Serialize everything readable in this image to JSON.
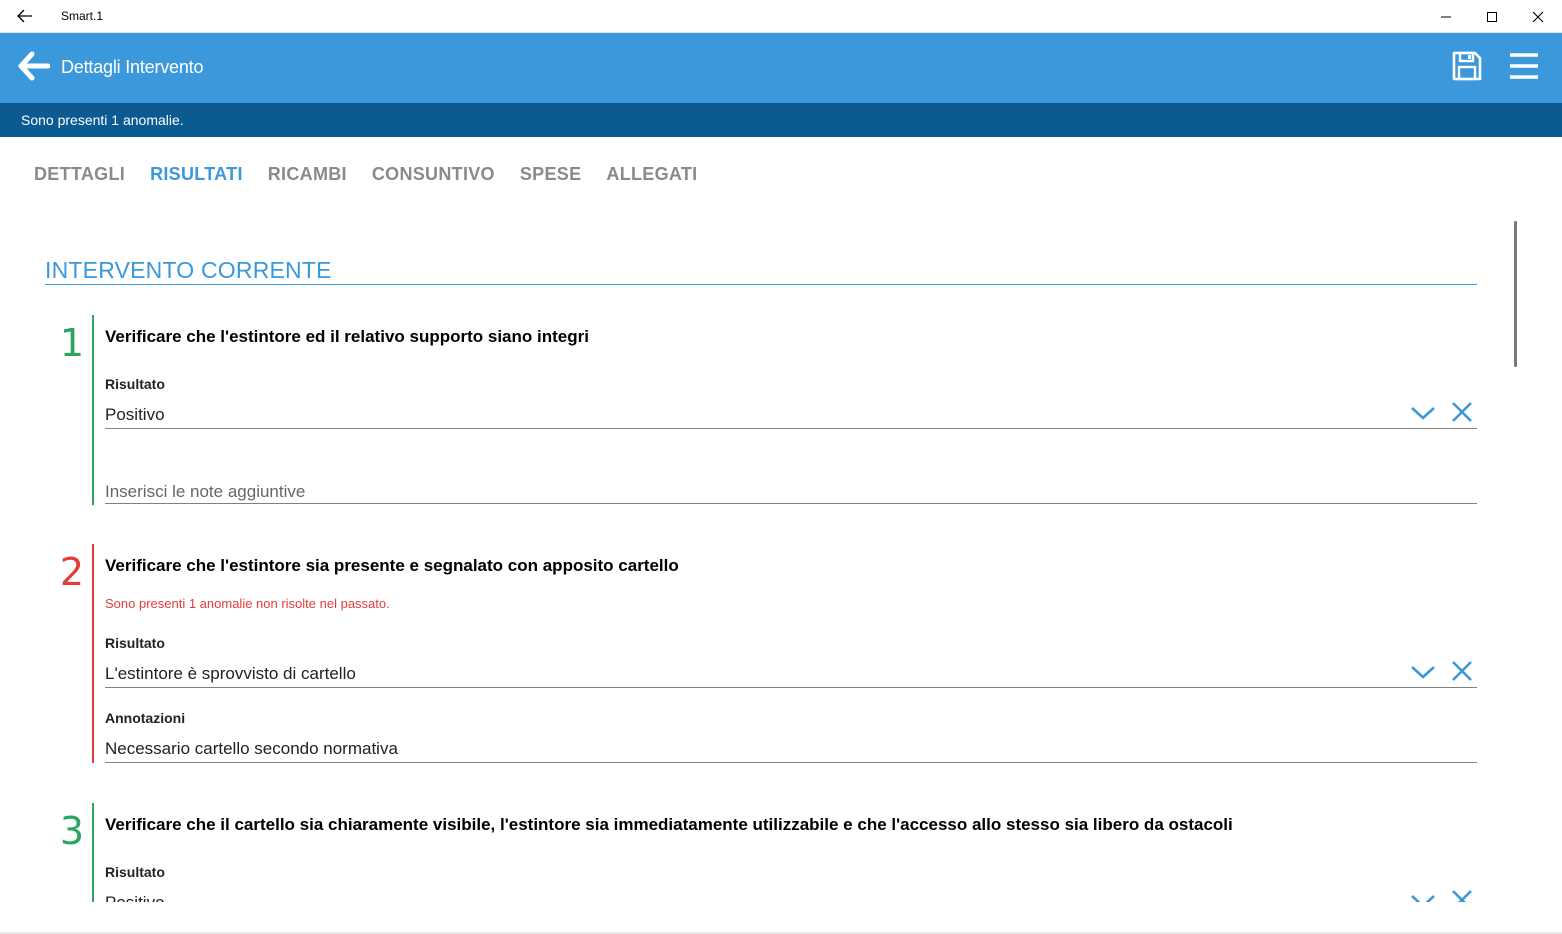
{
  "window": {
    "title": "Smart.1"
  },
  "appbar": {
    "title": "Dettagli Intervento"
  },
  "banner": {
    "text": "Sono presenti 1 anomalie."
  },
  "tabs": [
    {
      "label": "DETTAGLI"
    },
    {
      "label": "RISULTATI"
    },
    {
      "label": "RICAMBI"
    },
    {
      "label": "CONSUNTIVO"
    },
    {
      "label": "SPESE"
    },
    {
      "label": "ALLEGATI"
    }
  ],
  "active_tab": "RISULTATI",
  "section": {
    "title": "INTERVENTO CORRENTE"
  },
  "items": [
    {
      "number": "1",
      "status_color": "#2aa660",
      "question": "Verificare che l'estintore ed il relativo supporto siano integri",
      "result_label": "Risultato",
      "result_value": "Positivo",
      "notes_placeholder": "Inserisci le note aggiuntive"
    },
    {
      "number": "2",
      "status_color": "#e23c3c",
      "question": "Verificare che l'estintore sia presente e segnalato con apposito cartello",
      "warning": "Sono presenti 1 anomalie non risolte nel passato.",
      "result_label": "Risultato",
      "result_value": "L'estintore è sprovvisto di cartello",
      "notes_label": "Annotazioni",
      "notes_value": "Necessario cartello secondo normativa"
    },
    {
      "number": "3",
      "status_color": "#2aa660",
      "question": "Verificare che il cartello sia chiaramente visibile, l'estintore sia immediatamente utilizzabile e che l'accesso allo stesso sia libero da ostacoli",
      "result_label": "Risultato",
      "result_value": "Positivo"
    }
  ],
  "colors": {
    "appbar": "#3a98db",
    "banner": "#0b5a92",
    "accent": "#3a98db",
    "ok": "#2aa660",
    "anomaly": "#e23c3c"
  },
  "icons": {
    "window_back": "arrow-left-icon",
    "app_back": "arrow-left-bold-icon",
    "save": "floppy-disk-icon",
    "menu": "hamburger-menu-icon",
    "dropdown": "chevron-down-icon",
    "clear": "close-x-icon"
  }
}
